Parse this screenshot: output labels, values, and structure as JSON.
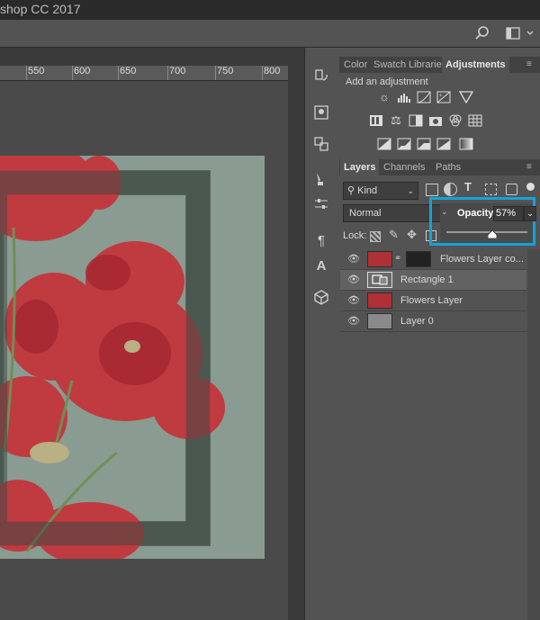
{
  "window": {
    "title_fragment": "shop CC 2017"
  },
  "ruler": {
    "ticks": [
      "550",
      "600",
      "650",
      "700",
      "750",
      "800"
    ]
  },
  "adjustments_panel": {
    "tabs": [
      "Color",
      "Swatch",
      "Librarie",
      "Adjustments"
    ],
    "active_tab": "Adjustments",
    "heading": "Add an adjustment",
    "icons_row1": [
      "brightness-icon",
      "levels-icon",
      "curves-icon",
      "exposure-icon",
      "vibrance-icon"
    ],
    "icons_row2": [
      "hue-saturation-icon",
      "color-balance-icon",
      "black-white-icon",
      "photo-filter-icon",
      "channel-mixer-icon",
      "color-lookup-icon"
    ],
    "icons_row3": [
      "invert-icon",
      "posterize-icon",
      "threshold-icon",
      "selective-color-icon",
      "gradient-map-icon"
    ]
  },
  "layers_panel": {
    "tabs": [
      "Layers",
      "Channels",
      "Paths"
    ],
    "active_tab": "Layers",
    "filter_kind": "Kind",
    "blend_mode": "Normal",
    "opacity_label": "Opacity:",
    "opacity_value": "57%",
    "opacity_level": 0.57,
    "lock_label": "Lock:",
    "layers": [
      {
        "name": "Flowers Layer co...",
        "selected": false,
        "visible": true
      },
      {
        "name": "Rectangle 1",
        "selected": true,
        "visible": true
      },
      {
        "name": "Flowers Layer",
        "selected": false,
        "visible": true
      },
      {
        "name": "Layer 0",
        "selected": false,
        "visible": true
      }
    ]
  },
  "colors": {
    "highlight": "#17a2d8",
    "panel_bg": "#535353",
    "document_bg": "#8a9b92",
    "flower_red": "#c4333a"
  }
}
